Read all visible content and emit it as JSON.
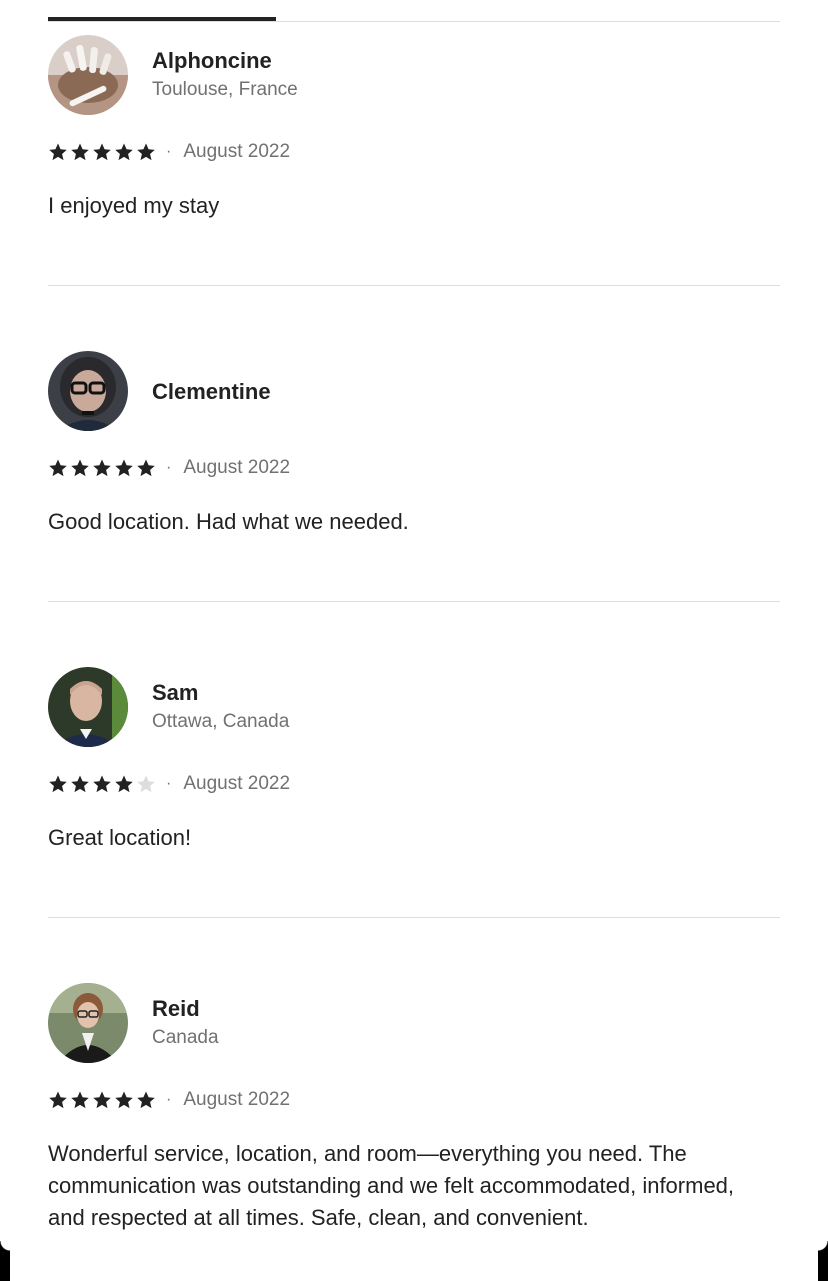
{
  "colors": {
    "text_primary": "#222222",
    "text_secondary": "#717171",
    "divider": "#dddddd",
    "star_filled": "#222222",
    "star_empty": "#dddddd"
  },
  "separator": "·",
  "reviews": [
    {
      "name": "Alphoncine",
      "location": "Toulouse, France",
      "rating": 5,
      "date": "August 2022",
      "text": "I enjoyed my stay",
      "avatar_icon": "nails-photo-avatar"
    },
    {
      "name": "Clementine",
      "location": "",
      "rating": 5,
      "date": "August 2022",
      "text": "Good location. Had what we needed.",
      "avatar_icon": "person-glasses-avatar"
    },
    {
      "name": "Sam",
      "location": "Ottawa, Canada",
      "rating": 4,
      "date": "August 2022",
      "text": "Great location!",
      "avatar_icon": "person-suit-avatar"
    },
    {
      "name": "Reid",
      "location": "Canada",
      "rating": 5,
      "date": "August 2022",
      "text": "Wonderful service, location, and room—everything you need. The communication was outstanding and we felt accommodated, informed, and respected at all times. Safe, clean, and convenient.",
      "avatar_icon": "person-blazer-avatar"
    }
  ]
}
